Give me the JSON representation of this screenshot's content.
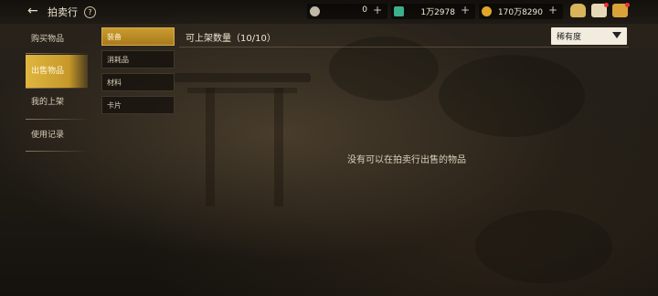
{
  "header": {
    "title": "拍卖行",
    "help_icon": "?",
    "currencies": [
      {
        "icon": "silver-coin-icon",
        "value": "0"
      },
      {
        "icon": "green-gem-icon",
        "value": "1万2978"
      },
      {
        "icon": "gold-coin-icon",
        "value": "170万8290"
      }
    ]
  },
  "nav": {
    "items": [
      {
        "label": "购买物品"
      },
      {
        "label": "出售物品"
      },
      {
        "label": "我的上架"
      },
      {
        "label": "使用记录"
      }
    ]
  },
  "categories": [
    {
      "label": "装备"
    },
    {
      "label": "消耗品"
    },
    {
      "label": "材料"
    },
    {
      "label": "卡片"
    }
  ],
  "listing": {
    "count_label": "可上架数量（10/10）",
    "sort_value": "稀有度",
    "empty_message": "没有可以在拍卖行出售的物品"
  }
}
